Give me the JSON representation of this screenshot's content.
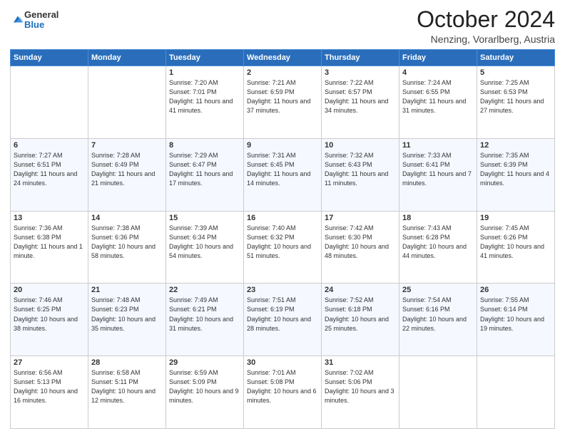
{
  "header": {
    "logo": {
      "general": "General",
      "blue": "Blue"
    },
    "title": "October 2024",
    "location": "Nenzing, Vorarlberg, Austria"
  },
  "weekdays": [
    "Sunday",
    "Monday",
    "Tuesday",
    "Wednesday",
    "Thursday",
    "Friday",
    "Saturday"
  ],
  "weeks": [
    [
      {
        "day": "",
        "detail": ""
      },
      {
        "day": "",
        "detail": ""
      },
      {
        "day": "1",
        "detail": "Sunrise: 7:20 AM\nSunset: 7:01 PM\nDaylight: 11 hours and 41 minutes."
      },
      {
        "day": "2",
        "detail": "Sunrise: 7:21 AM\nSunset: 6:59 PM\nDaylight: 11 hours and 37 minutes."
      },
      {
        "day": "3",
        "detail": "Sunrise: 7:22 AM\nSunset: 6:57 PM\nDaylight: 11 hours and 34 minutes."
      },
      {
        "day": "4",
        "detail": "Sunrise: 7:24 AM\nSunset: 6:55 PM\nDaylight: 11 hours and 31 minutes."
      },
      {
        "day": "5",
        "detail": "Sunrise: 7:25 AM\nSunset: 6:53 PM\nDaylight: 11 hours and 27 minutes."
      }
    ],
    [
      {
        "day": "6",
        "detail": "Sunrise: 7:27 AM\nSunset: 6:51 PM\nDaylight: 11 hours and 24 minutes."
      },
      {
        "day": "7",
        "detail": "Sunrise: 7:28 AM\nSunset: 6:49 PM\nDaylight: 11 hours and 21 minutes."
      },
      {
        "day": "8",
        "detail": "Sunrise: 7:29 AM\nSunset: 6:47 PM\nDaylight: 11 hours and 17 minutes."
      },
      {
        "day": "9",
        "detail": "Sunrise: 7:31 AM\nSunset: 6:45 PM\nDaylight: 11 hours and 14 minutes."
      },
      {
        "day": "10",
        "detail": "Sunrise: 7:32 AM\nSunset: 6:43 PM\nDaylight: 11 hours and 11 minutes."
      },
      {
        "day": "11",
        "detail": "Sunrise: 7:33 AM\nSunset: 6:41 PM\nDaylight: 11 hours and 7 minutes."
      },
      {
        "day": "12",
        "detail": "Sunrise: 7:35 AM\nSunset: 6:39 PM\nDaylight: 11 hours and 4 minutes."
      }
    ],
    [
      {
        "day": "13",
        "detail": "Sunrise: 7:36 AM\nSunset: 6:38 PM\nDaylight: 11 hours and 1 minute."
      },
      {
        "day": "14",
        "detail": "Sunrise: 7:38 AM\nSunset: 6:36 PM\nDaylight: 10 hours and 58 minutes."
      },
      {
        "day": "15",
        "detail": "Sunrise: 7:39 AM\nSunset: 6:34 PM\nDaylight: 10 hours and 54 minutes."
      },
      {
        "day": "16",
        "detail": "Sunrise: 7:40 AM\nSunset: 6:32 PM\nDaylight: 10 hours and 51 minutes."
      },
      {
        "day": "17",
        "detail": "Sunrise: 7:42 AM\nSunset: 6:30 PM\nDaylight: 10 hours and 48 minutes."
      },
      {
        "day": "18",
        "detail": "Sunrise: 7:43 AM\nSunset: 6:28 PM\nDaylight: 10 hours and 44 minutes."
      },
      {
        "day": "19",
        "detail": "Sunrise: 7:45 AM\nSunset: 6:26 PM\nDaylight: 10 hours and 41 minutes."
      }
    ],
    [
      {
        "day": "20",
        "detail": "Sunrise: 7:46 AM\nSunset: 6:25 PM\nDaylight: 10 hours and 38 minutes."
      },
      {
        "day": "21",
        "detail": "Sunrise: 7:48 AM\nSunset: 6:23 PM\nDaylight: 10 hours and 35 minutes."
      },
      {
        "day": "22",
        "detail": "Sunrise: 7:49 AM\nSunset: 6:21 PM\nDaylight: 10 hours and 31 minutes."
      },
      {
        "day": "23",
        "detail": "Sunrise: 7:51 AM\nSunset: 6:19 PM\nDaylight: 10 hours and 28 minutes."
      },
      {
        "day": "24",
        "detail": "Sunrise: 7:52 AM\nSunset: 6:18 PM\nDaylight: 10 hours and 25 minutes."
      },
      {
        "day": "25",
        "detail": "Sunrise: 7:54 AM\nSunset: 6:16 PM\nDaylight: 10 hours and 22 minutes."
      },
      {
        "day": "26",
        "detail": "Sunrise: 7:55 AM\nSunset: 6:14 PM\nDaylight: 10 hours and 19 minutes."
      }
    ],
    [
      {
        "day": "27",
        "detail": "Sunrise: 6:56 AM\nSunset: 5:13 PM\nDaylight: 10 hours and 16 minutes."
      },
      {
        "day": "28",
        "detail": "Sunrise: 6:58 AM\nSunset: 5:11 PM\nDaylight: 10 hours and 12 minutes."
      },
      {
        "day": "29",
        "detail": "Sunrise: 6:59 AM\nSunset: 5:09 PM\nDaylight: 10 hours and 9 minutes."
      },
      {
        "day": "30",
        "detail": "Sunrise: 7:01 AM\nSunset: 5:08 PM\nDaylight: 10 hours and 6 minutes."
      },
      {
        "day": "31",
        "detail": "Sunrise: 7:02 AM\nSunset: 5:06 PM\nDaylight: 10 hours and 3 minutes."
      },
      {
        "day": "",
        "detail": ""
      },
      {
        "day": "",
        "detail": ""
      }
    ]
  ]
}
